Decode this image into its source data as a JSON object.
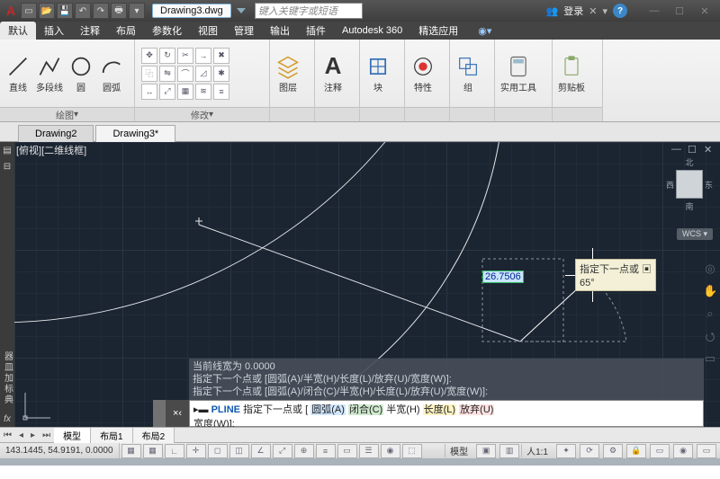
{
  "title": {
    "filename": "Drawing3.dwg",
    "search_placeholder": "键入关键字或短语",
    "login": "登录"
  },
  "menu": {
    "items": [
      "默认",
      "插入",
      "注释",
      "布局",
      "参数化",
      "视图",
      "管理",
      "输出",
      "插件",
      "Autodesk 360",
      "精选应用"
    ],
    "active": 0
  },
  "ribbon": {
    "draw": {
      "label": "绘图",
      "line": "直线",
      "polyline": "多段线",
      "circle": "圆",
      "arc": "圆弧"
    },
    "modify": {
      "label": "修改"
    },
    "layer": {
      "label": "图层"
    },
    "annotate": {
      "label": "注释",
      "text": "A"
    },
    "block": {
      "label": "块"
    },
    "properties": {
      "label": "特性"
    },
    "group": {
      "label": "组"
    },
    "utility": {
      "label": "实用工具"
    },
    "clipboard": {
      "label": "剪贴板"
    }
  },
  "doc_tabs": {
    "items": [
      "Drawing2",
      "Drawing3*"
    ],
    "active": 1
  },
  "viewport": {
    "label": "[俯视][二维线框]",
    "dyn_value": "26.7506",
    "tooltip": {
      "prompt": "指定下一点或",
      "angle": "65°"
    }
  },
  "compass": {
    "n": "北",
    "s": "南",
    "e": "东",
    "w": "西"
  },
  "wcs": "WCS",
  "left_palette_text": "器皿加标典",
  "fx": "fx",
  "cmd": {
    "hist0": "当前线宽为  0.0000",
    "hist1": "指定下一个点或 [圆弧(A)/半宽(H)/长度(L)/放弃(U)/宽度(W)]:",
    "hist2": "指定下一个点或 [圆弧(A)/闭合(C)/半宽(H)/长度(L)/放弃(U)/宽度(W)]:",
    "gutter": "×‹",
    "cmdname": "PLINE",
    "prompt_head": "▸▬ ",
    "prompt_main": " 指定下一点或 [ ",
    "opt_arc": "圆弧(A)",
    "opt_close": "闭合(C)",
    "opt_half": "半宽(H)",
    "opt_len": "长度(L)",
    "opt_undo": "放弃(U)",
    "line2": "宽度(W)]:"
  },
  "model_tabs": {
    "items": [
      "模型",
      "布局1",
      "布局2"
    ],
    "active": 0
  },
  "status": {
    "coord": "143.1445, 54.9191, 0.0000",
    "model": "模型",
    "scale": "1:1",
    "annoscale": "人1:1"
  }
}
